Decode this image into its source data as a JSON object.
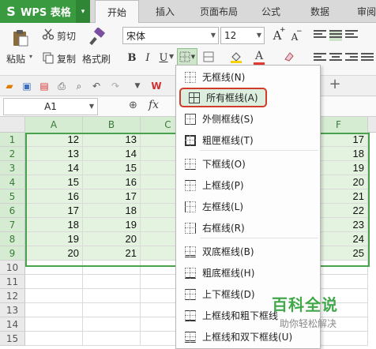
{
  "app": {
    "logo": "S",
    "title": "WPS 表格",
    "caret": "▾"
  },
  "tabs": [
    "开始",
    "插入",
    "页面布局",
    "公式",
    "数据",
    "审阅"
  ],
  "active_tab": "开始",
  "ribbon": {
    "paste": "粘贴",
    "paste_caret": "▾",
    "cut": "剪切",
    "copy": "复制",
    "format_painter": "格式刷",
    "font_name": "宋体",
    "font_size": "12",
    "grow_font": "A",
    "shrink_font": "A",
    "bold": "B",
    "italic": "I",
    "underline": "U",
    "font_color": "A"
  },
  "namebox": "A1",
  "formula_fx": "fx",
  "columns": [
    "A",
    "B",
    "C",
    "F"
  ],
  "rows": [
    {
      "n": "1",
      "a": "12",
      "b": "13",
      "f": "17"
    },
    {
      "n": "2",
      "a": "13",
      "b": "14",
      "f": "18"
    },
    {
      "n": "3",
      "a": "14",
      "b": "15",
      "f": "19"
    },
    {
      "n": "4",
      "a": "15",
      "b": "16",
      "f": "20"
    },
    {
      "n": "5",
      "a": "16",
      "b": "17",
      "f": "21"
    },
    {
      "n": "6",
      "a": "17",
      "b": "18",
      "f": "22"
    },
    {
      "n": "7",
      "a": "18",
      "b": "19",
      "f": "23"
    },
    {
      "n": "8",
      "a": "19",
      "b": "20",
      "f": "24"
    },
    {
      "n": "9",
      "a": "20",
      "b": "21",
      "f": "25"
    },
    {
      "n": "10",
      "a": "",
      "b": "",
      "f": ""
    },
    {
      "n": "11",
      "a": "",
      "b": "",
      "f": ""
    },
    {
      "n": "12",
      "a": "",
      "b": "",
      "f": ""
    },
    {
      "n": "13",
      "a": "",
      "b": "",
      "f": ""
    },
    {
      "n": "14",
      "a": "",
      "b": "",
      "f": ""
    },
    {
      "n": "15",
      "a": "",
      "b": "",
      "f": ""
    }
  ],
  "menu": {
    "items": [
      {
        "label": "无框线(N)",
        "icon": "no-border-icon"
      },
      {
        "label": "所有框线(A)",
        "icon": "all-borders-icon",
        "highlighted": true
      },
      {
        "label": "外侧框线(S)",
        "icon": "outside-borders-icon"
      },
      {
        "label": "粗匣框线(T)",
        "icon": "thick-box-border-icon"
      },
      {
        "label": "下框线(O)",
        "icon": "bottom-border-icon"
      },
      {
        "label": "上框线(P)",
        "icon": "top-border-icon"
      },
      {
        "label": "左框线(L)",
        "icon": "left-border-icon"
      },
      {
        "label": "右框线(R)",
        "icon": "right-border-icon"
      },
      {
        "label": "双底框线(B)",
        "icon": "double-bottom-border-icon"
      },
      {
        "label": "粗底框线(H)",
        "icon": "thick-bottom-border-icon"
      },
      {
        "label": "上下框线(D)",
        "icon": "top-bottom-border-icon"
      },
      {
        "label": "上框线和粗下框线",
        "icon": "top-thick-bottom-border-icon"
      },
      {
        "label": "上框线和双下框线(U)",
        "icon": "top-double-bottom-border-icon"
      }
    ]
  },
  "watermark": {
    "title": "百科全说",
    "subtitle": "助你轻松解决"
  },
  "colors": {
    "accent": "#3a9a3f",
    "selection_fill": "#e4f3df",
    "selection_border": "#4aa24f",
    "highlight_ring": "#d23b2b"
  }
}
